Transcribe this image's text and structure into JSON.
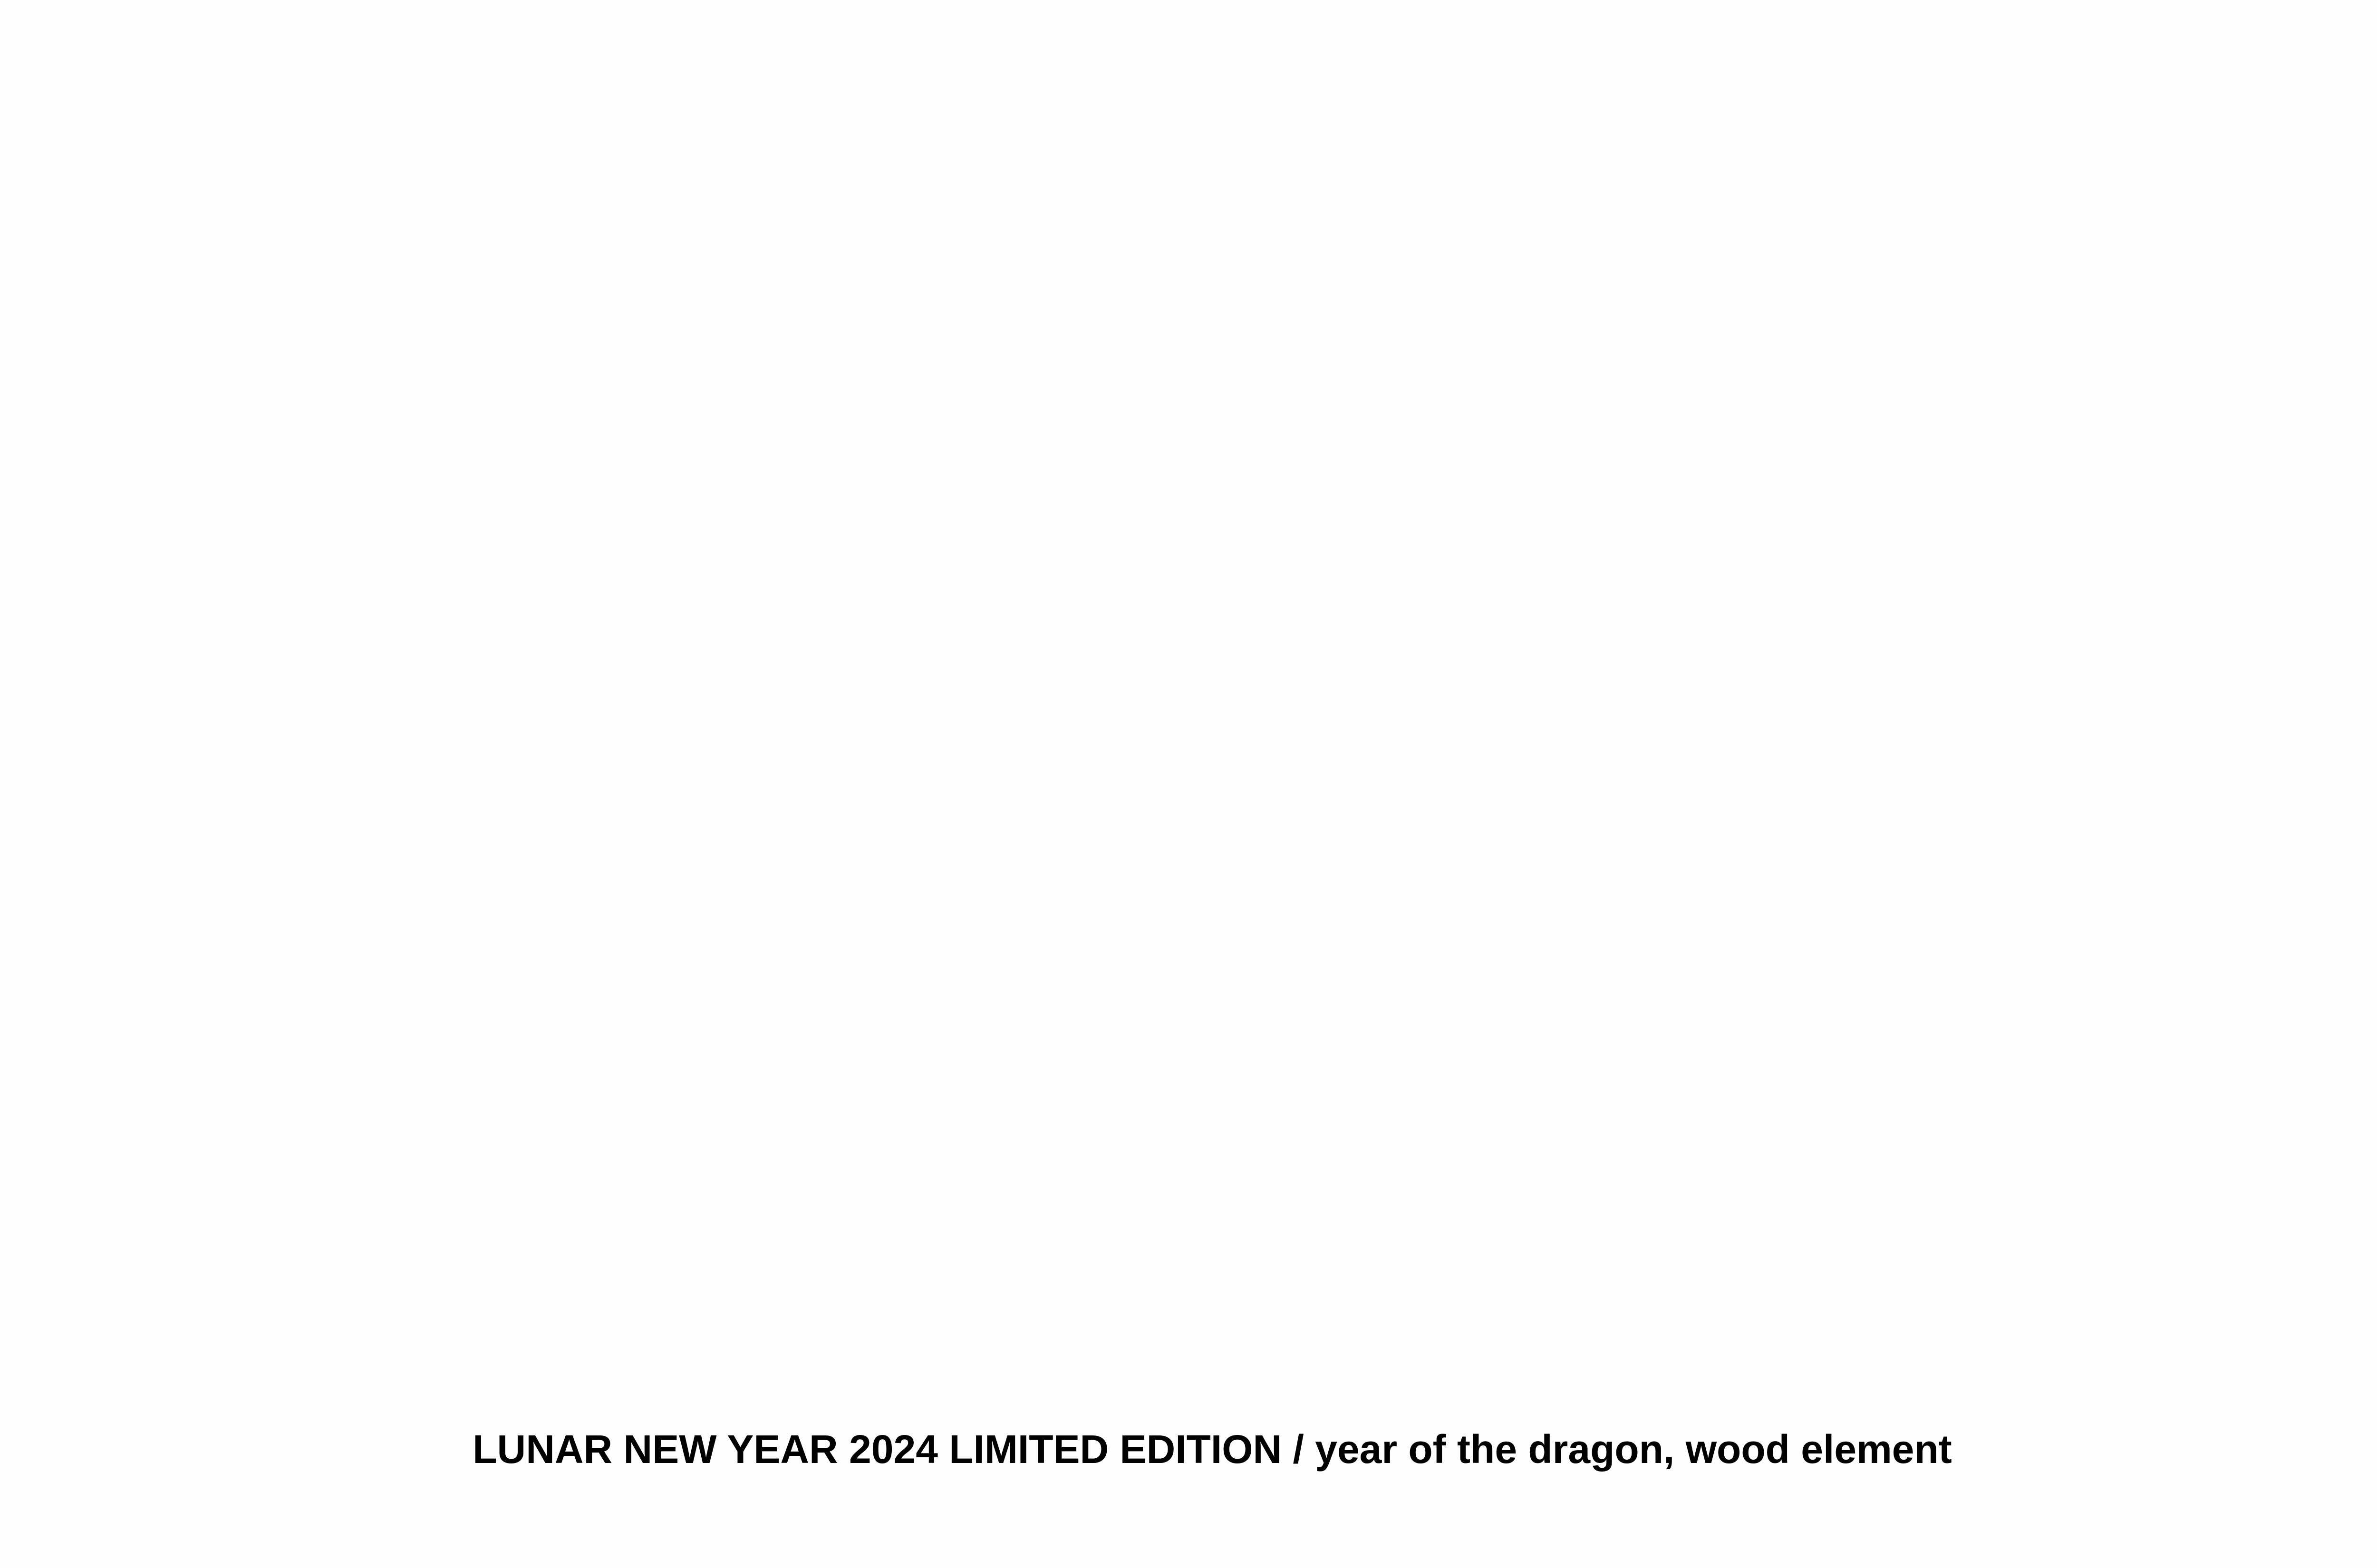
{
  "caption": {
    "text": "LUNAR NEW YEAR 2024 LIMITED EDITION / year of the dragon, wood element"
  },
  "colors": {
    "background": "#fffefe",
    "text": "#000000"
  }
}
